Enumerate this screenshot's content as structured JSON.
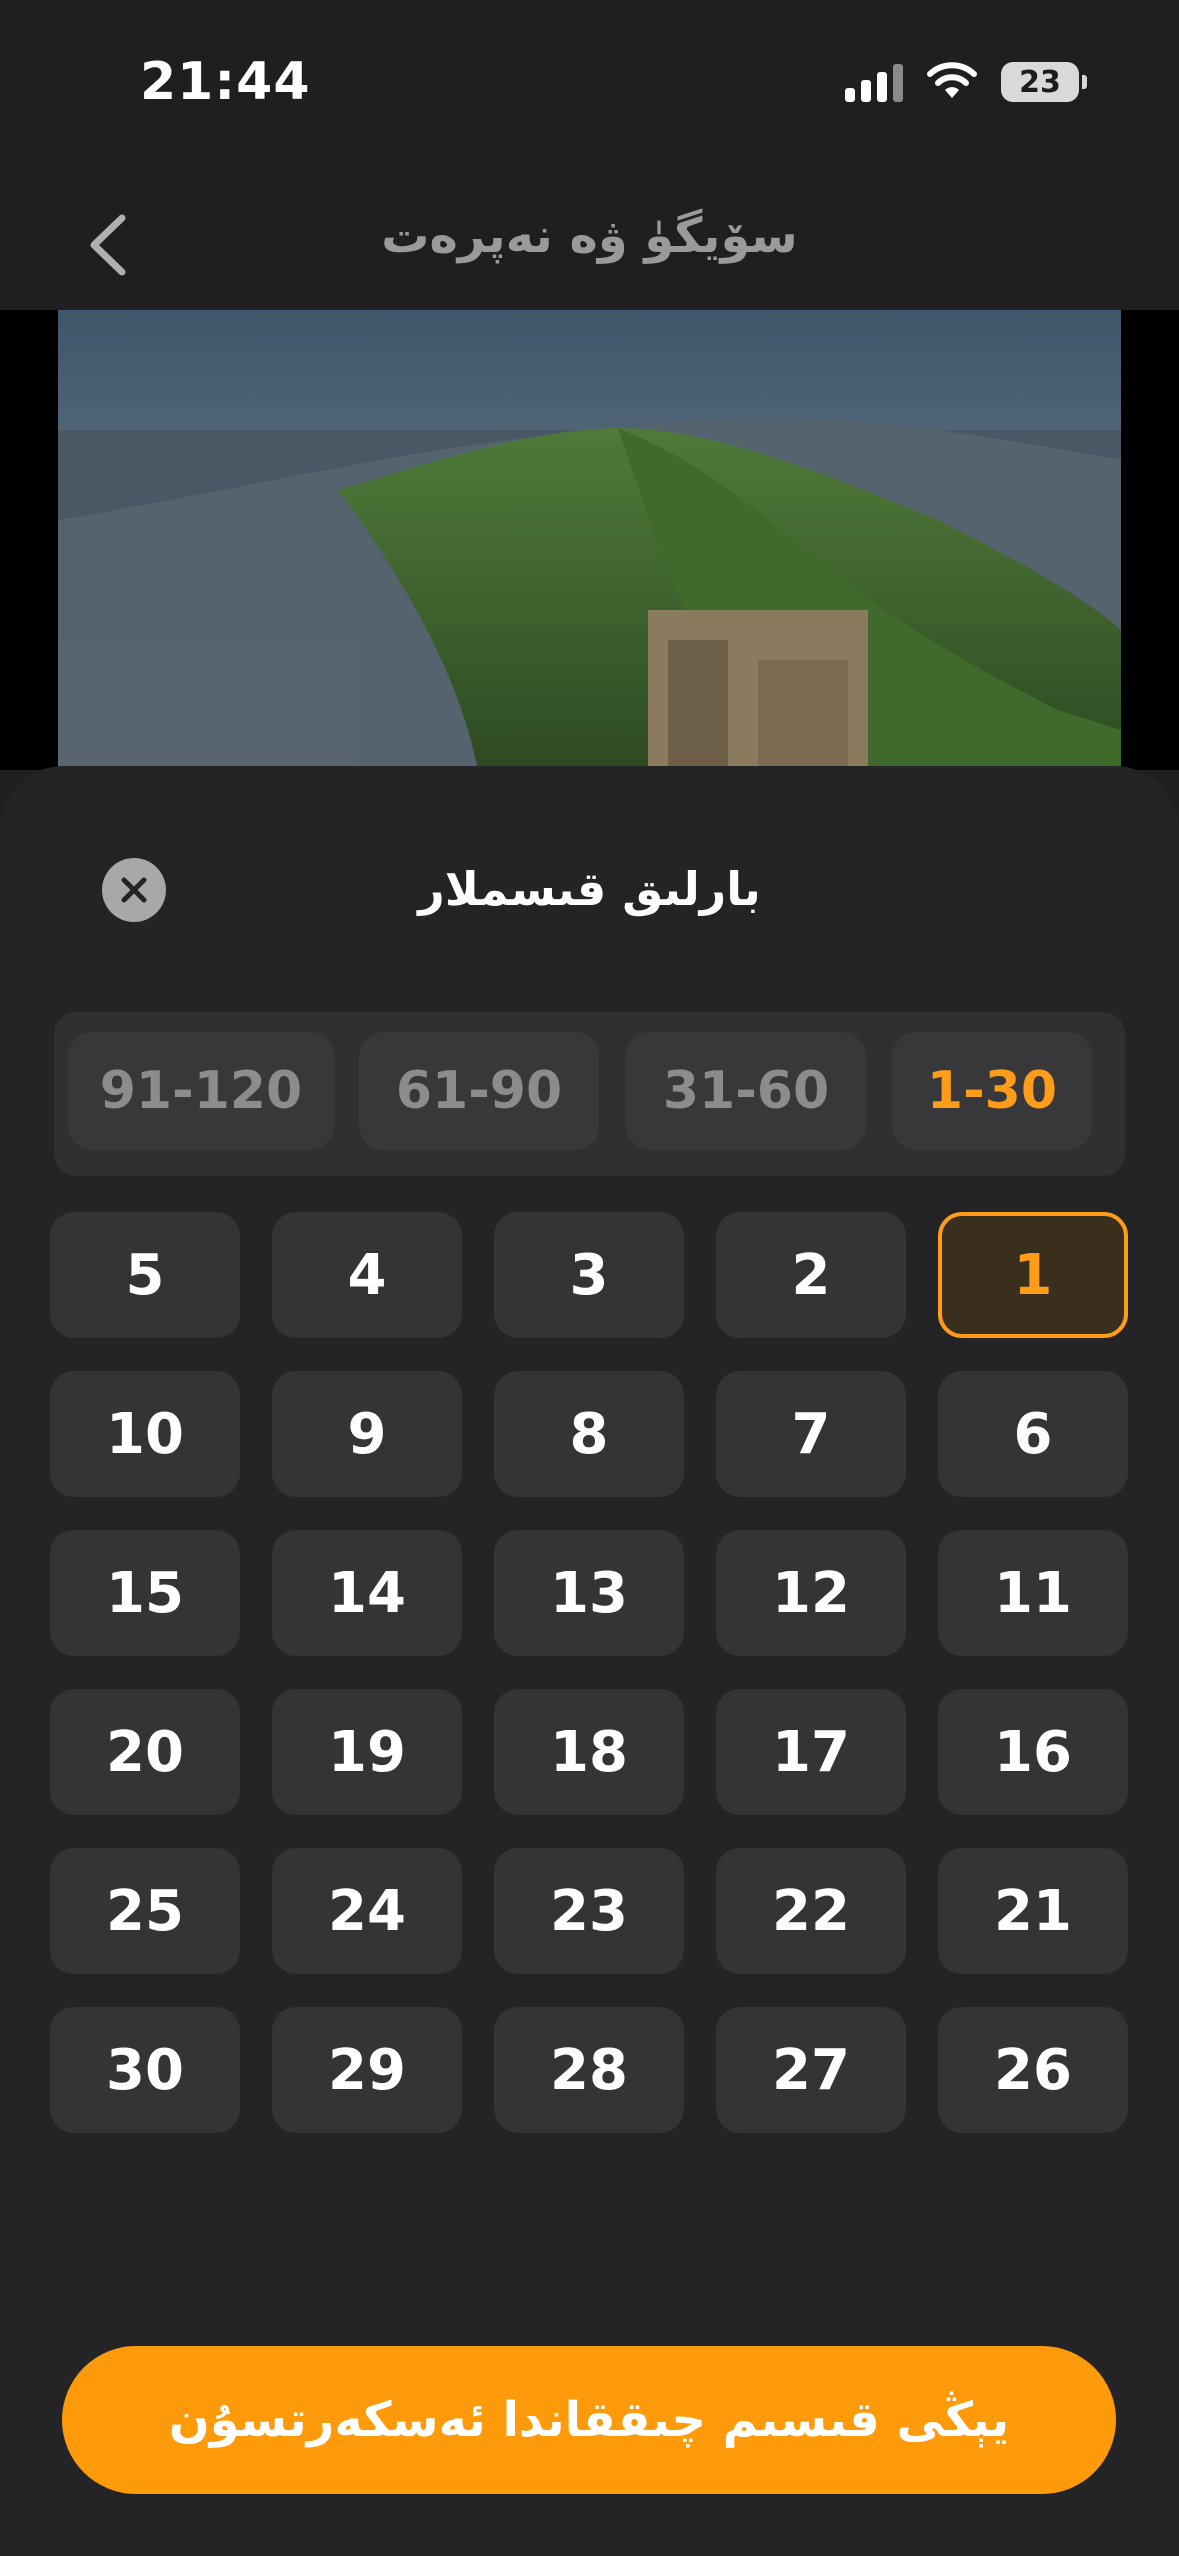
{
  "status_bar": {
    "time": "21:44",
    "battery": "23"
  },
  "header": {
    "title": "سۆيگۈ ۋە نەپرەت"
  },
  "sheet": {
    "title": "بارلىق قىسملار",
    "range_tabs": [
      {
        "label": "91-120",
        "active": false
      },
      {
        "label": "61-90",
        "active": false
      },
      {
        "label": "31-60",
        "active": false
      },
      {
        "label": "1-30",
        "active": true
      }
    ],
    "episodes": [
      "1",
      "2",
      "3",
      "4",
      "5",
      "6",
      "7",
      "8",
      "9",
      "10",
      "11",
      "12",
      "13",
      "14",
      "15",
      "16",
      "17",
      "18",
      "19",
      "20",
      "21",
      "22",
      "23",
      "24",
      "25",
      "26",
      "27",
      "28",
      "29",
      "30"
    ],
    "selected_episode": "1",
    "cta_label": "يېڭى قىسىم چىققاندا ئەسكەرتسۇن"
  },
  "colors": {
    "accent": "#ff9c1a",
    "background": "#1f1f21",
    "sheet": "#242426",
    "tile": "#343436"
  }
}
